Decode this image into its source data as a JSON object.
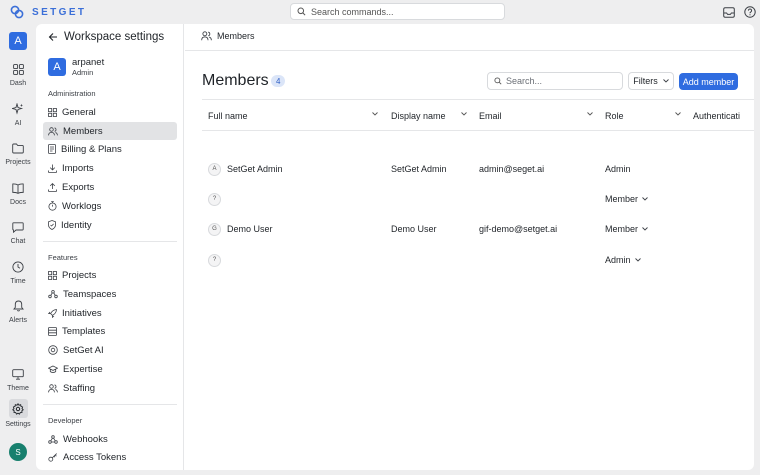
{
  "app": {
    "name": "SETGET",
    "accent": "#2f6ce0"
  },
  "topbar": {
    "command_placeholder": "Search commands..."
  },
  "rail": {
    "workspace_initial": "A",
    "items": [
      {
        "label": "Dash",
        "icon": "dashboard-icon"
      },
      {
        "label": "AI",
        "icon": "sparkle-icon"
      },
      {
        "label": "Projects",
        "icon": "folder-icon"
      },
      {
        "label": "Docs",
        "icon": "book-icon"
      },
      {
        "label": "Chat",
        "icon": "chat-icon"
      },
      {
        "label": "Time",
        "icon": "clock-icon"
      },
      {
        "label": "Alerts",
        "icon": "bell-icon"
      },
      {
        "label": "Theme",
        "icon": "monitor-icon"
      },
      {
        "label": "Settings",
        "icon": "gear-icon"
      }
    ],
    "user_initial": "S"
  },
  "settings": {
    "title": "Workspace settings",
    "workspace": {
      "initial": "A",
      "name": "arpanet",
      "role": "Admin"
    },
    "administration": {
      "label": "Administration",
      "items": [
        "General",
        "Members",
        "Billing & Plans",
        "Imports",
        "Exports",
        "Worklogs",
        "Identity"
      ]
    },
    "features": {
      "label": "Features",
      "items": [
        "Projects",
        "Teamspaces",
        "Initiatives",
        "Templates",
        "SetGet AI",
        "Expertise",
        "Staffing"
      ]
    },
    "developer": {
      "label": "Developer",
      "items": [
        "Webhooks",
        "Access Tokens"
      ]
    }
  },
  "breadcrumb": {
    "label": "Members"
  },
  "members": {
    "title": "Members",
    "count": "4",
    "search_placeholder": "Search...",
    "filters_label": "Filters",
    "add_label": "Add member",
    "columns": [
      "Full name",
      "Display name",
      "Email",
      "Role",
      "Authenticati"
    ],
    "rows": [
      {
        "initial": "A",
        "full_name": "SetGet Admin",
        "display_name": "SetGet Admin",
        "email": "admin@seget.ai",
        "role": "Admin",
        "role_dropdown": false
      },
      {
        "initial": "?",
        "full_name": "",
        "display_name": "",
        "email": "",
        "role": "Member",
        "role_dropdown": true
      },
      {
        "initial": "G",
        "full_name": "Demo User",
        "display_name": "Demo User",
        "email": "gif-demo@setget.ai",
        "role": "Member",
        "role_dropdown": true
      },
      {
        "initial": "?",
        "full_name": "",
        "display_name": "",
        "email": "",
        "role": "Admin",
        "role_dropdown": true
      }
    ]
  }
}
